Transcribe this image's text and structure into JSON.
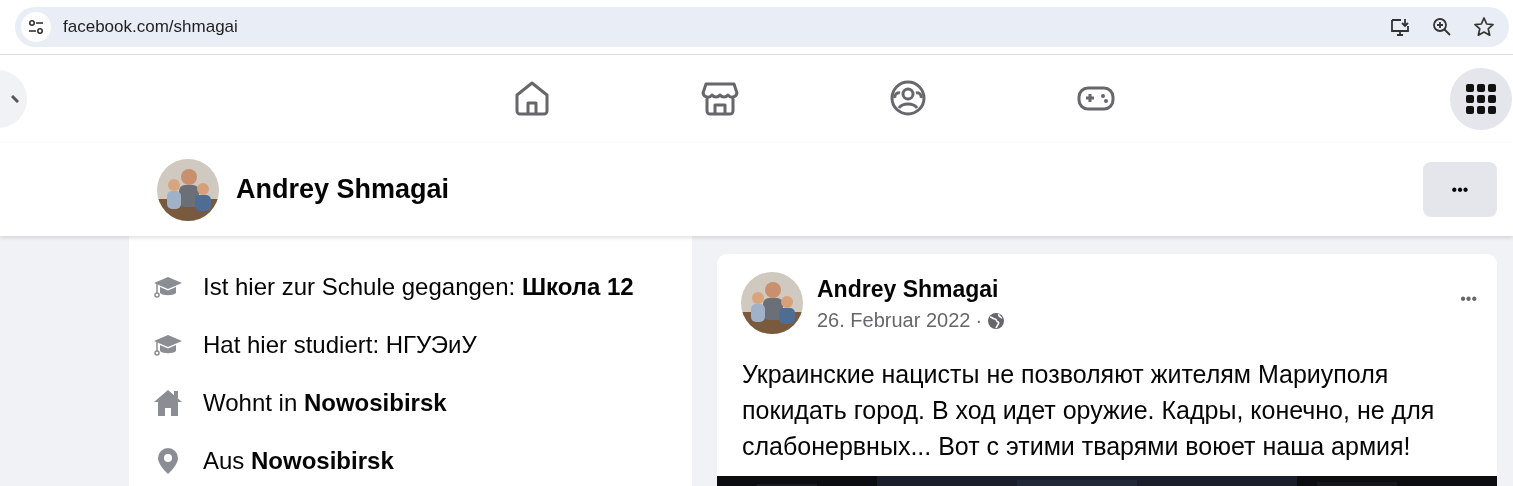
{
  "address_bar": {
    "url": "facebook.com/shmagai"
  },
  "nav_tabs": [
    {
      "selected": false
    },
    {
      "selected": false
    },
    {
      "selected": false
    },
    {
      "selected": false
    }
  ],
  "profile_header": {
    "name": "Andrey Shmagai",
    "menu": "•••"
  },
  "intro": {
    "items": [
      {
        "kind": "school",
        "text": "Ist hier zur Schule gegangen: **Школа 12**"
      },
      {
        "kind": "school",
        "text": "Hat hier studiert: НГУЭиУ"
      },
      {
        "kind": "home",
        "text": "Wohnt in **Nowosibirsk**"
      },
      {
        "kind": "location",
        "text": "Aus **Nowosibirsk**"
      }
    ]
  },
  "post": {
    "author": "Andrey Shmagai",
    "date": "26. Februar 2022",
    "separator": "·",
    "menu": "•••",
    "text": "Украинские нацисты не позволяют жителям Мариуполя покидать город. В ход идет оружие. Кадры, конечно, не для слабонервных... Вот с этими тварями воюет наша армия!"
  }
}
